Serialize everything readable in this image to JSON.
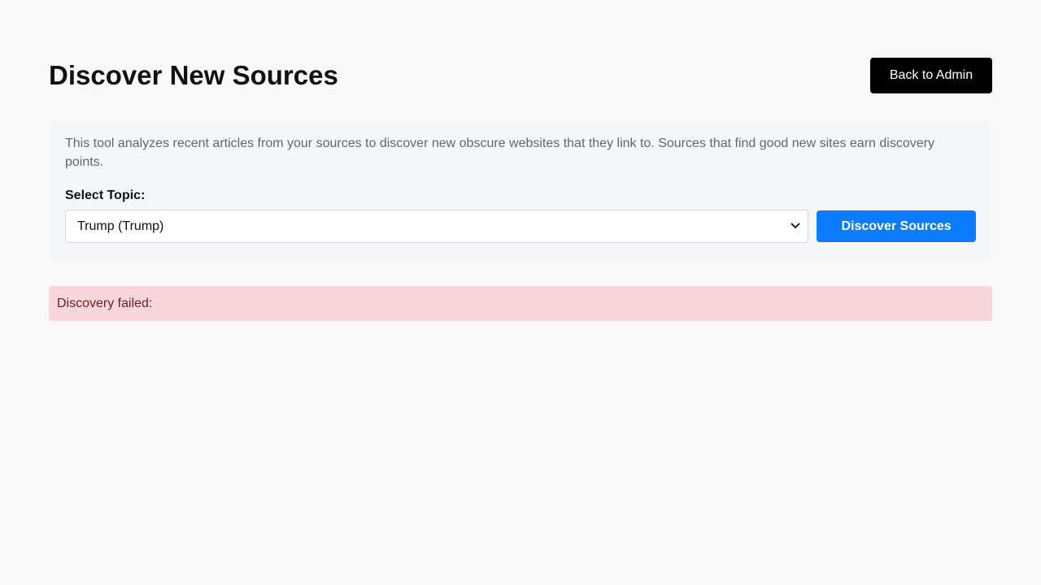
{
  "header": {
    "title": "Discover New Sources",
    "back_button_label": "Back to Admin"
  },
  "panel": {
    "description": "This tool analyzes recent articles from your sources to discover new obscure websites that they link to. Sources that find good new sites earn discovery points.",
    "topic_label": "Select Topic:",
    "topic_selected": "Trump (Trump)",
    "discover_button_label": "Discover Sources"
  },
  "error": {
    "message": "Discovery failed:"
  },
  "colors": {
    "background": "#f9f9f9",
    "primary": "#0a7cff",
    "back_button": "#000000",
    "error_background": "#f7d7da",
    "error_text": "#721c24"
  },
  "icons": {
    "select_chevron": "chevron-down-icon"
  }
}
